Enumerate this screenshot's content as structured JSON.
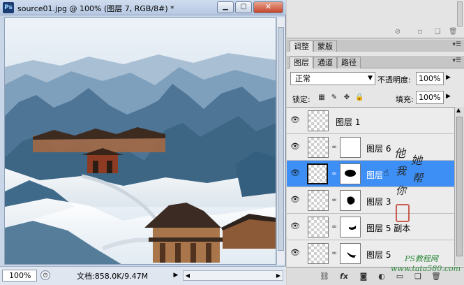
{
  "document": {
    "app_logo": "Ps",
    "title": "source01.jpg @ 100% (图层 7, RGB/8#) *",
    "zoom": "100%",
    "doc_info": "文档:858.0K/9.47M"
  },
  "panels": {
    "adjust_tabs": [
      {
        "label": "调整",
        "active": true
      },
      {
        "label": "蒙版",
        "active": false
      }
    ],
    "layers_tabs": [
      {
        "label": "图层",
        "active": true
      },
      {
        "label": "通道",
        "active": false
      },
      {
        "label": "路径",
        "active": false
      }
    ]
  },
  "layers_panel": {
    "blend_mode": "正常",
    "opacity_label": "不透明度:",
    "opacity_value": "100%",
    "lock_label": "锁定:",
    "fill_label": "填充:",
    "fill_value": "100%",
    "layers": [
      {
        "name": "图层 1",
        "has_mask": false,
        "selected": false
      },
      {
        "name": "图层 6",
        "has_mask": true,
        "selected": false
      },
      {
        "name": "图层",
        "has_mask": true,
        "selected": true
      },
      {
        "name": "图层 3",
        "has_mask": true,
        "selected": false
      },
      {
        "name": "图层 5 副本",
        "has_mask": true,
        "selected": false
      },
      {
        "name": "图层 5",
        "has_mask": true,
        "selected": false
      }
    ]
  },
  "watermark": {
    "chars": [
      "他",
      "她",
      "我",
      "帮",
      "你"
    ],
    "site_label": "PS教程网",
    "site_url": "www.tata580.com"
  },
  "colors": {
    "selected_row": "#3d8ff5",
    "watermark_green": "#2f8a3e",
    "seal_red": "#c0392b"
  }
}
